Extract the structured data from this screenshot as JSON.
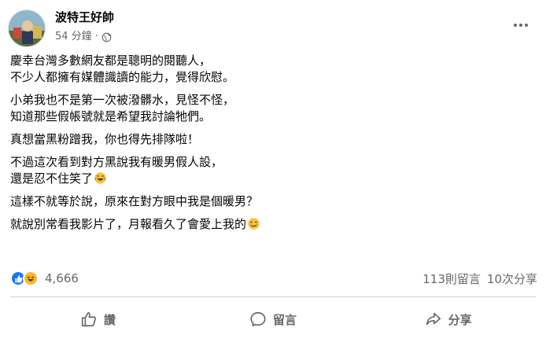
{
  "post": {
    "author": "波特王好帥",
    "time": "54 分鐘",
    "separator": "·",
    "paragraphs": [
      {
        "lines": [
          "慶幸台灣多數網友都是聰明的閱聽人，",
          "不少人都擁有媒體識讀的能力，覺得欣慰。"
        ]
      },
      {
        "lines": [
          "小弟我也不是第一次被潑髒水，見怪不怪，",
          "知道那些假帳號就是希望我討論牠們。"
        ]
      },
      {
        "lines": [
          "真想當黑粉蹭我，你也得先排隊啦！"
        ]
      },
      {
        "lines": [
          "不過這次看到對方黑說我有暖男假人設，",
          "還是忍不住笑了"
        ]
      },
      {
        "lines": [
          "這樣不就等於說，原來在對方眼中我是個暖男？"
        ]
      },
      {
        "lines": [
          "就說別常看我影片了，月報看久了會愛上我的"
        ]
      }
    ]
  },
  "stats": {
    "reaction_count": "4,666",
    "comments": "113則留言",
    "shares": "10次分享"
  },
  "actions": {
    "like": "讚",
    "comment": "留言",
    "share": "分享"
  },
  "colors": {
    "like_blue": "#1877f2",
    "haha_yellow": "#f7b928",
    "secondary_text": "#65676b",
    "divider": "#ced0d4"
  }
}
